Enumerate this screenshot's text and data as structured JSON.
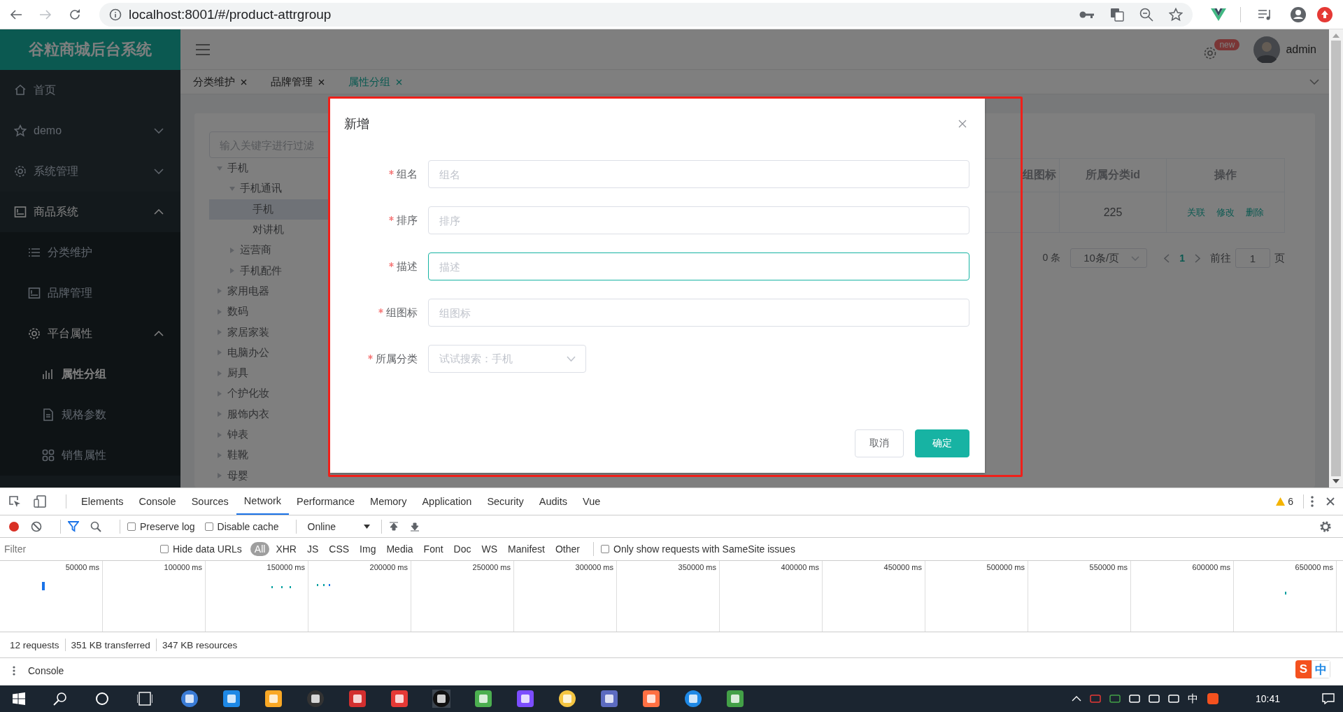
{
  "browser": {
    "url": "localhost:8001/#/product-attrgroup"
  },
  "app": {
    "logo": "谷粒商城后台系统",
    "sidebar": {
      "items": [
        {
          "label": "首页",
          "selected": false
        },
        {
          "label": "demo",
          "expanded": false,
          "selected": false
        },
        {
          "label": "系统管理",
          "expanded": false,
          "selected": false
        },
        {
          "label": "商品系统",
          "expanded": true,
          "selected": false,
          "children": [
            {
              "label": "分类维护",
              "selected": false
            },
            {
              "label": "品牌管理",
              "selected": false
            },
            {
              "label": "平台属性",
              "expanded": true,
              "selected": false,
              "children": [
                {
                  "label": "属性分组",
                  "selected": true
                },
                {
                  "label": "规格参数",
                  "selected": false
                },
                {
                  "label": "销售属性",
                  "selected": false
                }
              ]
            }
          ]
        }
      ]
    },
    "header": {
      "badge": "new",
      "user": "admin"
    },
    "tabs": [
      {
        "label": "分类维护",
        "selected": false
      },
      {
        "label": "品牌管理",
        "selected": false
      },
      {
        "label": "属性分组",
        "selected": true
      }
    ],
    "tree": {
      "filter_placeholder": "输入关键字进行过滤",
      "nodes": [
        {
          "label": "手机",
          "expanded": true,
          "children": [
            {
              "label": "手机通讯",
              "expanded": true,
              "children": [
                {
                  "label": "手机",
                  "selected": true
                },
                {
                  "label": "对讲机",
                  "selected": false
                }
              ]
            },
            {
              "label": "运营商",
              "expanded": false
            },
            {
              "label": "手机配件",
              "expanded": false
            }
          ]
        },
        {
          "label": "家用电器",
          "expanded": false
        },
        {
          "label": "数码",
          "expanded": false
        },
        {
          "label": "家居家装",
          "expanded": false
        },
        {
          "label": "电脑办公",
          "expanded": false
        },
        {
          "label": "厨具",
          "expanded": false
        },
        {
          "label": "个护化妆",
          "expanded": false
        },
        {
          "label": "服饰内衣",
          "expanded": false
        },
        {
          "label": "钟表",
          "expanded": false
        },
        {
          "label": "鞋靴",
          "expanded": false
        },
        {
          "label": "母婴",
          "expanded": false
        }
      ]
    },
    "table": {
      "columns": [
        "组图标",
        "所属分类id",
        "操作"
      ],
      "rows": [
        {
          "cells": [
            "",
            "225"
          ],
          "actions": [
            "关联",
            "修改",
            "删除"
          ]
        }
      ]
    },
    "pagination": {
      "total": "0 条",
      "page_size": "10条/页",
      "pages": [
        {
          "label": "1",
          "selected": true
        }
      ],
      "goto_label": "前往",
      "goto_value": "1",
      "goto_unit": "页"
    }
  },
  "dialog": {
    "title": "新增",
    "fields": [
      {
        "kind": "input",
        "label": "组名",
        "placeholder": "组名",
        "required": true,
        "focused": false
      },
      {
        "kind": "input",
        "label": "排序",
        "placeholder": "排序",
        "required": true,
        "focused": false
      },
      {
        "kind": "input",
        "label": "描述",
        "placeholder": "描述",
        "required": true,
        "focused": true
      },
      {
        "kind": "input",
        "label": "组图标",
        "placeholder": "组图标",
        "required": true,
        "focused": false
      },
      {
        "kind": "select",
        "label": "所属分类",
        "placeholder": "试试搜索：手机",
        "required": true,
        "focused": false
      }
    ],
    "buttons": [
      {
        "label": "取消",
        "kind": "default"
      },
      {
        "label": "确定",
        "kind": "primary"
      }
    ]
  },
  "devtools": {
    "tabs": [
      {
        "label": "Elements",
        "selected": false
      },
      {
        "label": "Console",
        "selected": false
      },
      {
        "label": "Sources",
        "selected": false
      },
      {
        "label": "Network",
        "selected": true
      },
      {
        "label": "Performance",
        "selected": false
      },
      {
        "label": "Memory",
        "selected": false
      },
      {
        "label": "Application",
        "selected": false
      },
      {
        "label": "Security",
        "selected": false
      },
      {
        "label": "Audits",
        "selected": false
      },
      {
        "label": "Vue",
        "selected": false
      }
    ],
    "warnings": "6",
    "toolbar_checks": [
      {
        "label": "Preserve log",
        "checked": false
      },
      {
        "label": "Disable cache",
        "checked": false
      }
    ],
    "throttling": "Online",
    "filter_placeholder": "Filter",
    "hide_data_urls": {
      "label": "Hide data URLs",
      "checked": false
    },
    "types": [
      {
        "label": "All",
        "selected": true
      },
      {
        "label": "XHR",
        "selected": false
      },
      {
        "label": "JS",
        "selected": false
      },
      {
        "label": "CSS",
        "selected": false
      },
      {
        "label": "Img",
        "selected": false
      },
      {
        "label": "Media",
        "selected": false
      },
      {
        "label": "Font",
        "selected": false
      },
      {
        "label": "Doc",
        "selected": false
      },
      {
        "label": "WS",
        "selected": false
      },
      {
        "label": "Manifest",
        "selected": false
      },
      {
        "label": "Other",
        "selected": false
      }
    ],
    "samesite": {
      "label": "Only show requests with SameSite issues",
      "checked": false
    },
    "timeline_ticks": [
      "50000 ms",
      "100000 ms",
      "150000 ms",
      "200000 ms",
      "250000 ms",
      "300000 ms",
      "350000 ms",
      "400000 ms",
      "450000 ms",
      "500000 ms",
      "550000 ms",
      "600000 ms",
      "650000 ms"
    ],
    "status": [
      "12 requests",
      "351 KB transferred",
      "347 KB resources"
    ],
    "drawer_tab": "Console"
  },
  "taskbar": {
    "ime_logo": "S",
    "ime_mode": "中",
    "language": "中",
    "time": "10:41"
  }
}
